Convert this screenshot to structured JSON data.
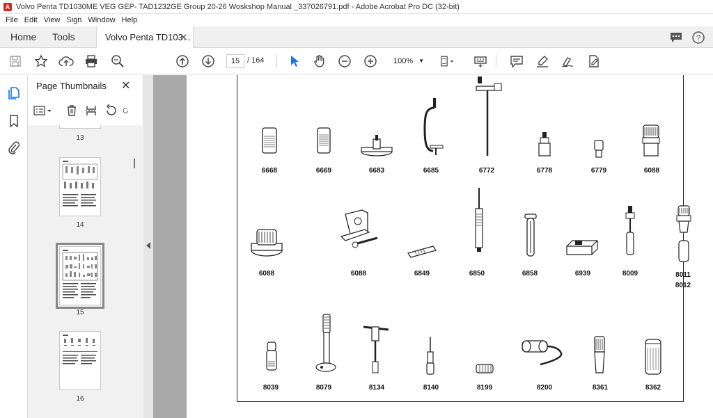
{
  "window": {
    "title": "Volvo Penta TD1030ME VEG GEP- TAD1232GE Group 20-26 Woskshop Manual _337026791.pdf - Adobe Acrobat Pro DC (32-bit)"
  },
  "menu": [
    "File",
    "Edit",
    "View",
    "Sign",
    "Window",
    "Help"
  ],
  "tabs": {
    "home": "Home",
    "tools": "Tools",
    "document": "Volvo Penta TD103...",
    "close": "✕"
  },
  "toolbar": {
    "current_page": "15",
    "total_pages": "/ 164",
    "zoom": "100%"
  },
  "thumbnails_panel": {
    "title": "Page Thumbnails",
    "close": "✕",
    "pages": [
      "13",
      "14",
      "15",
      "16"
    ],
    "selected_page": "15"
  },
  "tools_list": {
    "row1": [
      "6668",
      "6669",
      "6683",
      "6685",
      "6772",
      "6778",
      "6779",
      "6088"
    ],
    "row2": [
      "6088",
      "6088",
      "6849",
      "6850",
      "6858",
      "6939",
      "8009",
      "8011",
      "8012"
    ],
    "row3": [
      "8039",
      "8079",
      "8134",
      "8140",
      "8199",
      "8200",
      "8361",
      "8362"
    ]
  },
  "colors": {
    "accent": "#1473e6",
    "app_icon": "#d8261e",
    "doc_background": "#a9a9a9"
  }
}
